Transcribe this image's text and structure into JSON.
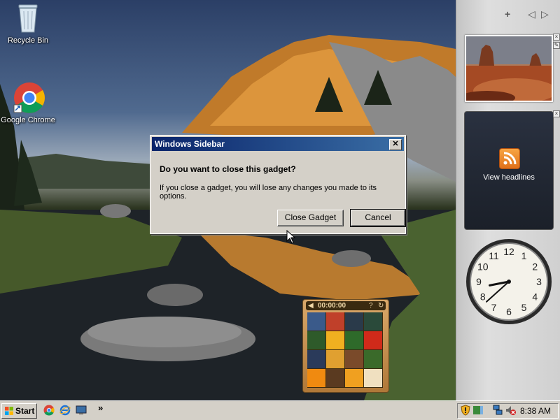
{
  "desktop": {
    "icons": [
      {
        "label": "Recycle Bin",
        "icon": "recycle-bin-icon"
      },
      {
        "label": "Google Chrome",
        "icon": "chrome-icon"
      }
    ]
  },
  "dialog": {
    "title": "Windows Sidebar",
    "close_glyph": "✕",
    "heading": "Do you want to close this gadget?",
    "message": "If you close a gadget, you will lose any changes you made to its options.",
    "buttons": {
      "close_gadget": "Close Gadget",
      "cancel": "Cancel"
    }
  },
  "sidebar": {
    "add_glyph": "+",
    "prev_glyph": "◁",
    "next_glyph": "▷",
    "feed_label": "View headlines",
    "clock": {
      "hours": 8,
      "minutes": 38
    }
  },
  "puzzle": {
    "timer": "00:00:00",
    "help_glyph": "?",
    "tile_colors": [
      "#3a5a8a",
      "#c0402a",
      "#2a3a4a",
      "#2a4a3a",
      "#2e5a2a",
      "#f0b020",
      "#2e6a2a",
      "#d02a1a",
      "#2a3a5a",
      "#e0a030",
      "#7a4a2a",
      "#3a6a2a",
      "#f08a10",
      "#5a3a20",
      "#f0a020",
      "#f0e0c0"
    ]
  },
  "taskbar": {
    "start_label": "Start",
    "chevron": "»",
    "time": "8:38 AM"
  },
  "colors": {
    "title_bar": "#0a246a",
    "window_face": "#d4d0c8"
  }
}
